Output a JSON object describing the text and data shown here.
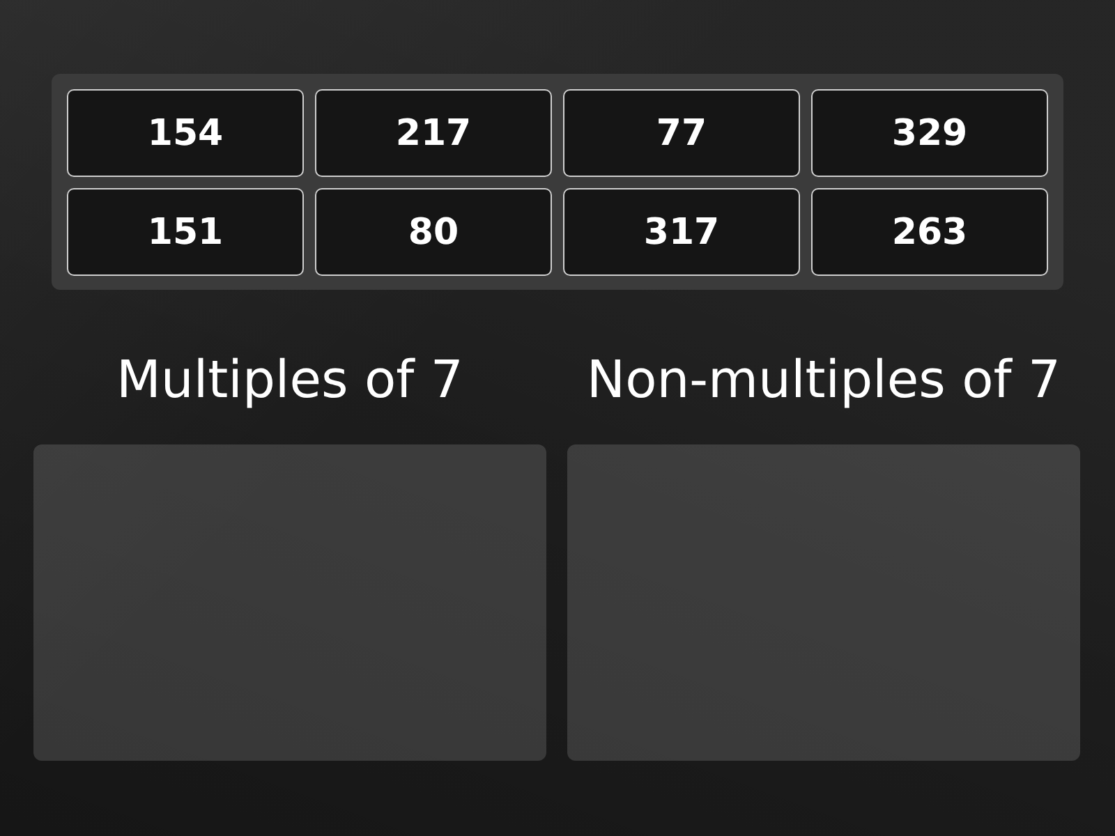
{
  "tiles": [
    {
      "label": "154"
    },
    {
      "label": "217"
    },
    {
      "label": "77"
    },
    {
      "label": "329"
    },
    {
      "label": "151"
    },
    {
      "label": "80"
    },
    {
      "label": "317"
    },
    {
      "label": "263"
    }
  ],
  "groups": [
    {
      "title": "Multiples of 7"
    },
    {
      "title": "Non-multiples of 7"
    }
  ]
}
